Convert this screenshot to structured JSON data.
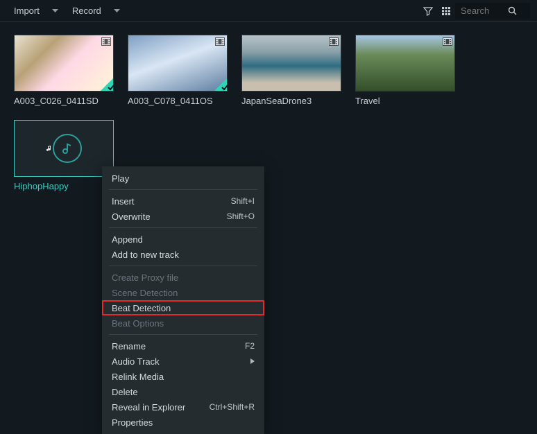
{
  "toolbar": {
    "import_label": "Import",
    "record_label": "Record",
    "search_placeholder": "Search"
  },
  "clips": [
    {
      "name": "A003_C026_0411SD",
      "type": "video",
      "checked": true,
      "thumb": "t1"
    },
    {
      "name": "A003_C078_0411OS",
      "type": "video",
      "checked": true,
      "thumb": "t2"
    },
    {
      "name": "JapanSeaDrone3",
      "type": "video",
      "checked": false,
      "thumb": "t3"
    },
    {
      "name": "Travel",
      "type": "video",
      "checked": false,
      "thumb": "t4"
    },
    {
      "name": "HiphopHappy",
      "type": "audio",
      "checked": false,
      "selected": true
    }
  ],
  "context_menu": [
    {
      "kind": "item",
      "label": "Play"
    },
    {
      "kind": "sep"
    },
    {
      "kind": "item",
      "label": "Insert",
      "shortcut": "Shift+I"
    },
    {
      "kind": "item",
      "label": "Overwrite",
      "shortcut": "Shift+O"
    },
    {
      "kind": "sep"
    },
    {
      "kind": "item",
      "label": "Append"
    },
    {
      "kind": "item",
      "label": "Add to new track"
    },
    {
      "kind": "sep"
    },
    {
      "kind": "item",
      "label": "Create Proxy file",
      "disabled": true
    },
    {
      "kind": "item",
      "label": "Scene Detection",
      "disabled": true
    },
    {
      "kind": "item",
      "label": "Beat Detection",
      "highlight": true
    },
    {
      "kind": "item",
      "label": "Beat Options",
      "disabled": true
    },
    {
      "kind": "sep"
    },
    {
      "kind": "item",
      "label": "Rename",
      "shortcut": "F2"
    },
    {
      "kind": "item",
      "label": "Audio Track",
      "submenu": true
    },
    {
      "kind": "item",
      "label": "Relink Media"
    },
    {
      "kind": "item",
      "label": "Delete"
    },
    {
      "kind": "item",
      "label": "Reveal in Explorer",
      "shortcut": "Ctrl+Shift+R"
    },
    {
      "kind": "item",
      "label": "Properties"
    }
  ]
}
